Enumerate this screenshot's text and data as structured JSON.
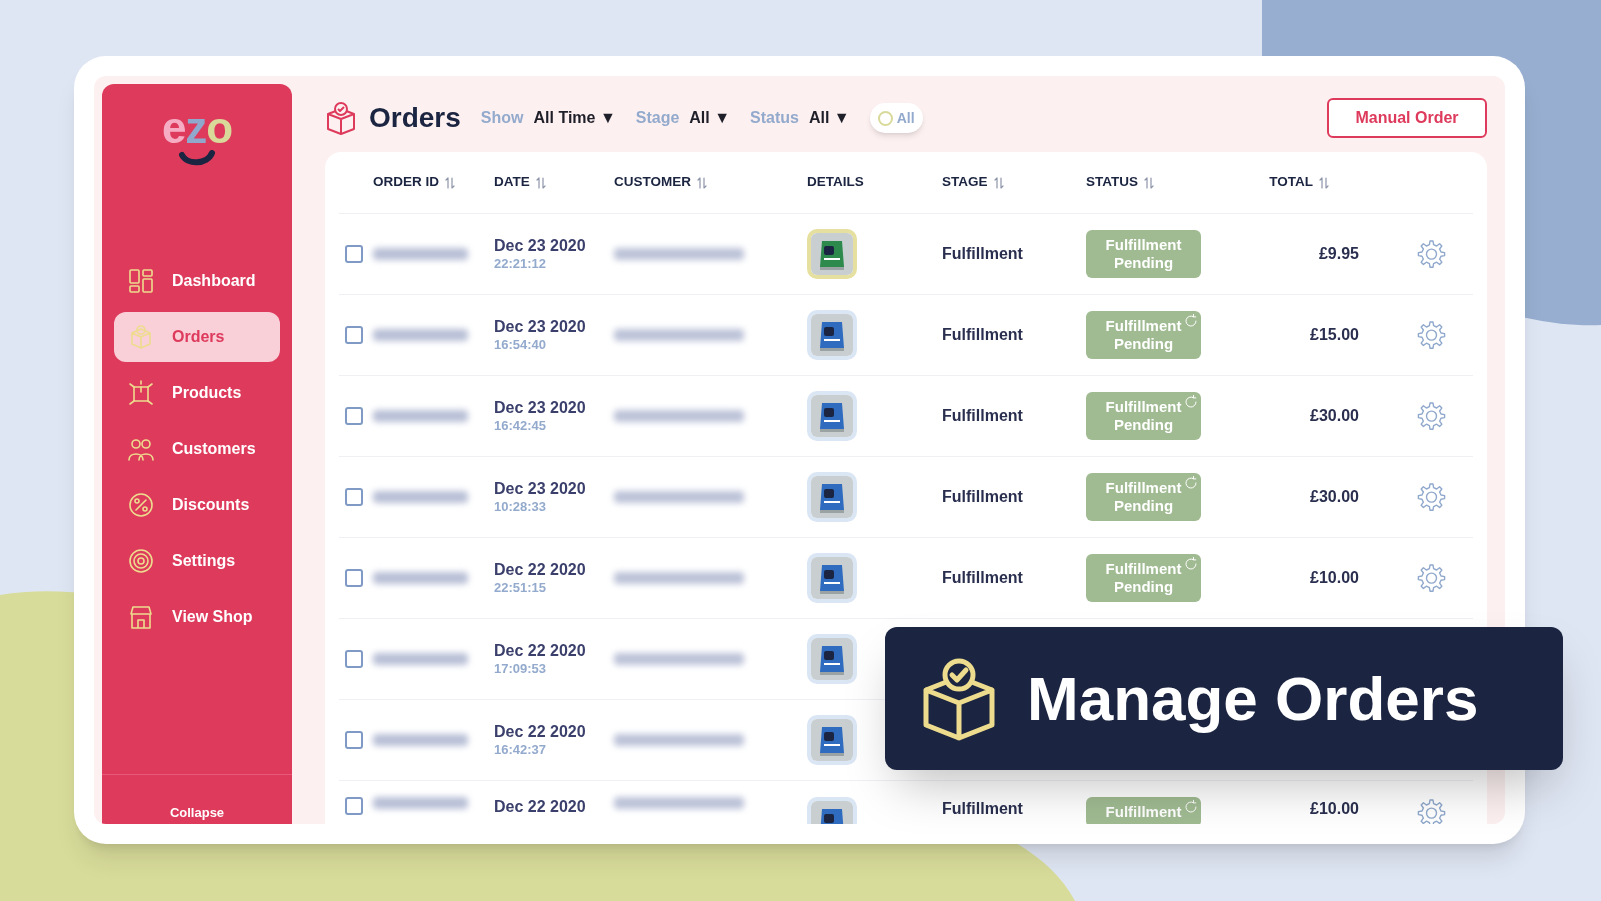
{
  "sidebar": {
    "logo": "ezo",
    "items": [
      {
        "label": "Dashboard",
        "selected": false
      },
      {
        "label": "Orders",
        "selected": true
      },
      {
        "label": "Products",
        "selected": false
      },
      {
        "label": "Customers",
        "selected": false
      },
      {
        "label": "Discounts",
        "selected": false
      },
      {
        "label": "Settings",
        "selected": false
      },
      {
        "label": "View Shop",
        "selected": false
      }
    ],
    "collapse": "Collapse"
  },
  "header": {
    "title": "Orders",
    "filters": [
      {
        "label": "Show",
        "value": "All Time ▼"
      },
      {
        "label": "Stage",
        "value": "All ▼"
      },
      {
        "label": "Status",
        "value": "All ▼"
      }
    ],
    "toggle": {
      "label": "All",
      "on": false
    },
    "button": "Manual Order"
  },
  "table": {
    "columns": [
      {
        "label": "ORDER ID",
        "sortable": true
      },
      {
        "label": "DATE",
        "sortable": true
      },
      {
        "label": "CUSTOMER",
        "sortable": true
      },
      {
        "label": "DETAILS",
        "sortable": false
      },
      {
        "label": "STAGE",
        "sortable": true
      },
      {
        "label": "STATUS",
        "sortable": true
      },
      {
        "label": "TOTAL",
        "sortable": true
      }
    ],
    "rows": [
      {
        "checked": false,
        "date": "Dec 23 2020",
        "time": "22:21:12",
        "highlighted": true,
        "color": "#2e8a4c",
        "stage": "Fulfillment",
        "status": "Fulfillment Pending",
        "syncing": false,
        "total": "£9.95"
      },
      {
        "checked": false,
        "date": "Dec 23 2020",
        "time": "16:54:40",
        "highlighted": false,
        "color": "#2f6cc0",
        "stage": "Fulfillment",
        "status": "Fulfillment Pending",
        "syncing": true,
        "total": "£15.00"
      },
      {
        "checked": false,
        "date": "Dec 23 2020",
        "time": "16:42:45",
        "highlighted": false,
        "color": "#2f6cc0",
        "stage": "Fulfillment",
        "status": "Fulfillment Pending",
        "syncing": true,
        "total": "£30.00"
      },
      {
        "checked": false,
        "date": "Dec 23 2020",
        "time": "10:28:33",
        "highlighted": false,
        "color": "#2f6cc0",
        "stage": "Fulfillment",
        "status": "Fulfillment Pending",
        "syncing": true,
        "total": "£30.00"
      },
      {
        "checked": false,
        "date": "Dec 22 2020",
        "time": "22:51:15",
        "highlighted": false,
        "color": "#2f6cc0",
        "stage": "Fulfillment",
        "status": "Fulfillment Pending",
        "syncing": true,
        "total": "£10.00"
      },
      {
        "checked": false,
        "date": "Dec 22 2020",
        "time": "17:09:53",
        "highlighted": false,
        "color": "#2f6cc0"
      },
      {
        "checked": false,
        "date": "Dec 22 2020",
        "time": "16:42:37",
        "highlighted": false,
        "color": "#2f6cc0"
      },
      {
        "checked": false,
        "date": "Dec 22 2020",
        "highlighted": false,
        "color": "#2f6cc0",
        "stage": "Fulfillment",
        "status": "Fulfillment",
        "syncing": true,
        "total": "£10.00"
      }
    ]
  },
  "banner": {
    "title": "Manage Orders"
  }
}
